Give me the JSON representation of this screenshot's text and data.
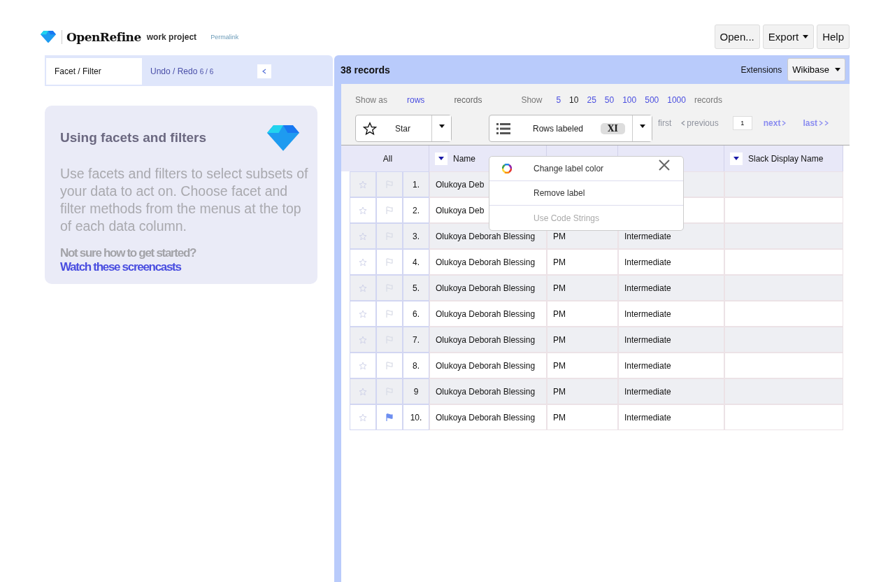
{
  "header": {
    "app_name": "OpenRefine",
    "project": "work project",
    "permalink": "Permalink",
    "buttons": [
      {
        "label": "Open...",
        "dropdown": false
      },
      {
        "label": "Export",
        "dropdown": true
      },
      {
        "label": "Help",
        "dropdown": false
      }
    ]
  },
  "left_panel": {
    "tabs": [
      {
        "label": "Facet / Filter",
        "selected": true
      },
      {
        "label": "Undo / Redo",
        "count": "6 / 6",
        "selected": false
      }
    ],
    "help_card": {
      "title": "Using facets and filters",
      "body": "Use facets and filters to select subsets of your data to act on. Choose facet and filter methods from the menus at the top of each data column.",
      "prompt": "Not sure how to get started?",
      "link": "Watch these screencasts"
    }
  },
  "data_panel": {
    "record_count": "38 records",
    "extensions_label": "Extensions",
    "extensions_menu": "Wikibase",
    "show_as": {
      "label": "Show as",
      "options": [
        {
          "label": "rows",
          "selected": false
        },
        {
          "label": "records",
          "selected": true
        }
      ]
    },
    "page_size": {
      "label": "Show",
      "options": [
        {
          "label": "5",
          "selected": false
        },
        {
          "label": "10",
          "selected": true
        },
        {
          "label": "25",
          "selected": false
        },
        {
          "label": "50",
          "selected": false
        },
        {
          "label": "100",
          "selected": false
        },
        {
          "label": "500",
          "selected": false
        },
        {
          "label": "1000",
          "selected": false
        }
      ],
      "unit": "records"
    },
    "star_button": "Star",
    "label_button": {
      "label": "Rows labeled",
      "badge": "XI"
    },
    "pagination": {
      "first": {
        "label": "first",
        "disabled": true
      },
      "previous": {
        "label": "previous",
        "disabled": true
      },
      "page": "1",
      "next": {
        "label": "next",
        "disabled": false
      },
      "last": {
        "label": "last",
        "disabled": false
      }
    },
    "table": {
      "columns": [
        {
          "label": "All",
          "menu": false
        },
        {
          "label": "Name",
          "menu": true
        },
        {},
        {},
        {
          "label": "Slack Display Name",
          "menu": true
        }
      ],
      "rows": [
        {
          "number": "1.",
          "name": "Olukoya Deb",
          "starred": false,
          "flagged": false
        },
        {
          "number": "2.",
          "name": "Olukoya Deb",
          "starred": false,
          "flagged": false
        },
        {
          "number": "3.",
          "name": "Olukoya Deborah Blessing",
          "role": "PM",
          "level": "Intermediate",
          "starred": false,
          "flagged": false
        },
        {
          "number": "4.",
          "name": "Olukoya Deborah Blessing",
          "role": "PM",
          "level": "Intermediate",
          "starred": false,
          "flagged": false
        },
        {
          "number": "5.",
          "name": "Olukoya Deborah Blessing",
          "role": "PM",
          "level": "Intermediate",
          "starred": false,
          "flagged": false
        },
        {
          "number": "6.",
          "name": "Olukoya Deborah Blessing",
          "role": "PM",
          "level": "Intermediate",
          "starred": false,
          "flagged": false
        },
        {
          "number": "7.",
          "name": "Olukoya Deborah Blessing",
          "role": "PM",
          "level": "Intermediate",
          "starred": false,
          "flagged": false
        },
        {
          "number": "8.",
          "name": "Olukoya Deborah Blessing",
          "role": "PM",
          "level": "Intermediate",
          "starred": false,
          "flagged": false
        },
        {
          "number": "9",
          "name": "Olukoya Deborah Blessing",
          "role": "PM",
          "level": "Intermediate",
          "starred": false,
          "flagged": false
        },
        {
          "number": "10.",
          "name": "Olukoya Deborah Blessing",
          "role": "PM",
          "level": "Intermediate",
          "starred": false,
          "flagged": true
        }
      ]
    },
    "label_menu": {
      "items": [
        {
          "label": "Change label color",
          "kind": "color",
          "disabled": false
        },
        {
          "label": "Remove label",
          "kind": "plain",
          "disabled": false
        },
        {
          "label": "Use Code Strings",
          "kind": "plain",
          "disabled": true
        }
      ]
    }
  }
}
